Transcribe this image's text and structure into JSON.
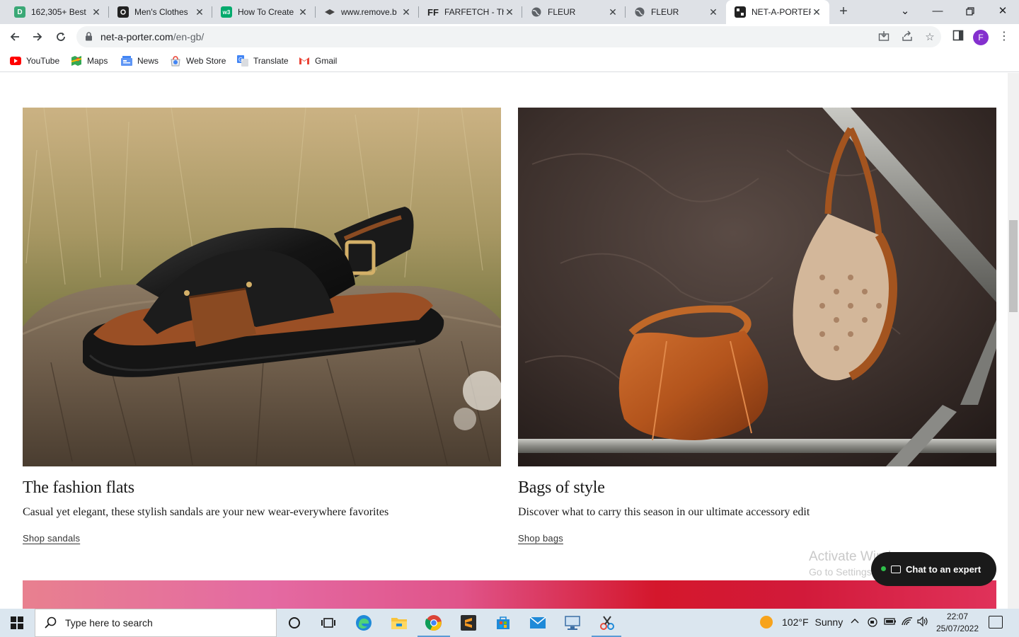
{
  "browser": {
    "tabs": [
      {
        "title": "162,305+ Best",
        "favicon": "d-letter-icon",
        "color": "#3aa876"
      },
      {
        "title": "Men's Clothes",
        "favicon": "camera-icon",
        "color": "#222222"
      },
      {
        "title": "How To Create",
        "favicon": "w3-icon",
        "color": "#04aa6d"
      },
      {
        "title": "www.remove.b",
        "favicon": "layers-icon",
        "color": "#444444"
      },
      {
        "title": "FARFETCH - Th",
        "favicon": "farfetch-icon",
        "color": "#222222"
      },
      {
        "title": "FLEUR",
        "favicon": "globe-icon",
        "color": "#5f6368"
      },
      {
        "title": "FLEUR",
        "favicon": "globe-icon",
        "color": "#5f6368"
      },
      {
        "title": "NET-A-PORTER",
        "favicon": "netaporter-icon",
        "color": "#222222"
      }
    ],
    "active_tab": 7,
    "url_host": "net-a-porter.com",
    "url_path": "/en-gb/",
    "profile_initial": "F",
    "bookmarks": [
      {
        "label": "YouTube",
        "icon": "youtube-icon"
      },
      {
        "label": "Maps",
        "icon": "maps-icon"
      },
      {
        "label": "News",
        "icon": "news-icon"
      },
      {
        "label": "Web Store",
        "icon": "webstore-icon"
      },
      {
        "label": "Translate",
        "icon": "translate-icon"
      },
      {
        "label": "Gmail",
        "icon": "gmail-icon"
      }
    ]
  },
  "content": {
    "cards": [
      {
        "title": "The fashion flats",
        "description": "Casual yet elegant, these stylish sandals are your new wear-everywhere favorites",
        "link": "Shop sandals",
        "image": "black leather crossover sandal on a tree stump in a grass field"
      },
      {
        "title": "Bags of style",
        "description": "Discover what to carry this season in our ultimate accessory edit",
        "link": "Shop bags",
        "image": "tan suede bucket bag and monogram hobo bag hanging on metal bars"
      }
    ],
    "chat_button": "Chat to an expert"
  },
  "watermark": {
    "line1": "Activate Windows",
    "line2": "Go to Settings to activate Windows."
  },
  "taskbar": {
    "search_placeholder": "Type here to search",
    "weather_temp": "102°F",
    "weather_text": "Sunny",
    "time": "22:07",
    "date": "25/07/2022"
  },
  "colors": {
    "chrome_tabstrip": "#dee1e6",
    "chat_bg": "#1a1a1a",
    "taskbar_bg": "#dbe6ef",
    "profile": "#8430ce"
  }
}
